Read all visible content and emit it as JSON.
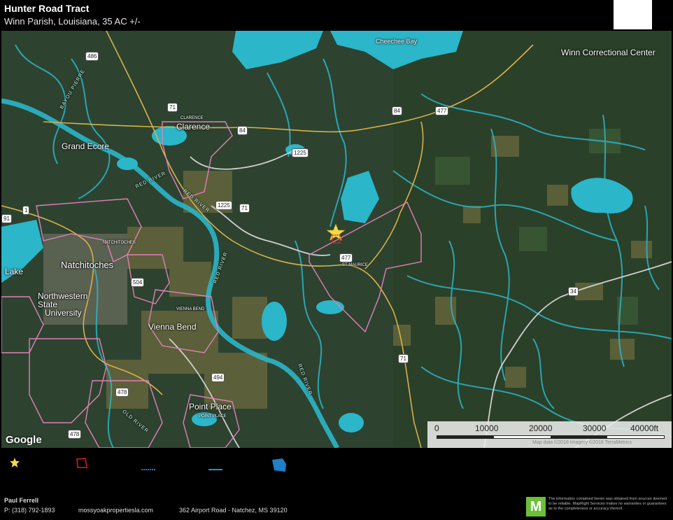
{
  "header": {
    "title": "Hunter Road Tract",
    "subtitle": "Winn Parish, Louisiana, 35 AC +/-"
  },
  "map": {
    "labels": {
      "winn_correctional": "Winn Correctional Center",
      "cheechee_bay": "Cheechee Bay",
      "clarence": "Clarence",
      "grand_ecore": "Grand Ecore",
      "natchitoches": "Natchitoches",
      "northwestern": "Northwestern",
      "state": "State",
      "university": "University",
      "vienna_bend": "Vienna Bend",
      "point_place": "Point Place",
      "lake": "Lake",
      "red_river_1": "RED RIVER",
      "red_river_2": "RED RIVER",
      "red_river_3": "RED RIVER",
      "red_river_4": "RED RIVER",
      "old_river": "OLD RIVER",
      "bayou_pierre": "BAYOU PIERRE",
      "saint_maurice": "ST MAURICE",
      "clarence_small": "CLARENCE",
      "natchitoches_small": "NATCHITOCHES",
      "vienna_small": "VIENNA BEND",
      "point_small": "POINT PLACE"
    },
    "shields": {
      "r486": "486",
      "r71a": "71",
      "r84a": "84",
      "r1225a": "1225",
      "r84b": "84",
      "r477a": "477",
      "r1225b": "1225",
      "r71b": "71",
      "r1": "1",
      "r477b": "477",
      "r504": "504",
      "r34": "34",
      "r71c": "71",
      "r494": "494",
      "r478a": "478",
      "r478b": "478",
      "r91": "91"
    },
    "google_logo": "Google",
    "scale": {
      "ticks": [
        "0",
        "10000",
        "20000",
        "30000",
        "40000ft"
      ],
      "attribution": "Map data ©2018 Imagery ©2018 TerraMetrics"
    }
  },
  "legend": {
    "items": [
      {
        "icon": "star-icon",
        "color": "#f5d94a"
      },
      {
        "icon": "red-boundary-icon",
        "color": "#e02020"
      },
      {
        "icon": "dashed-line-icon",
        "color": "#3a6fd8"
      },
      {
        "icon": "line-icon",
        "color": "#2a8fd0"
      },
      {
        "icon": "water-shape-icon",
        "color": "#1f7fc8"
      }
    ]
  },
  "footer": {
    "agent_name": "Paul Ferrell",
    "phone": "P: (318) 792-1893",
    "website": "mossyoakpropertiesla.com",
    "address": "362 Airport Road - Natchez, MS 39120",
    "logo_letter": "M",
    "disclaimer": "The information contained herein was obtained from sources deemed to be reliable. MapRight Services makes no warranties or guarantees as to the completeness or accuracy thereof."
  },
  "colors": {
    "water": "#2bb6c9",
    "parish_boundary": "#e07fb8",
    "road_yellow": "#d9b14a",
    "subject_marker": "#f5d94a"
  }
}
